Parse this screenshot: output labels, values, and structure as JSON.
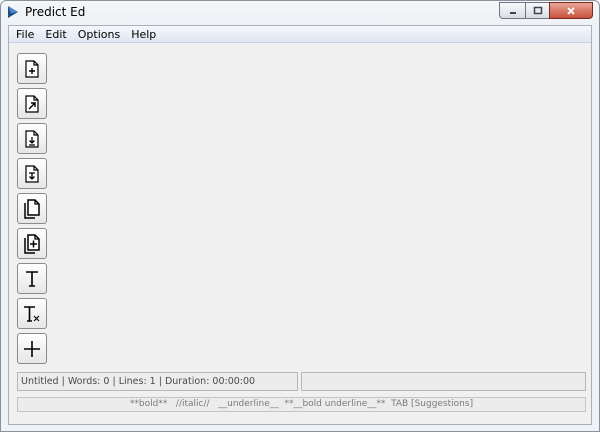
{
  "window": {
    "title": "Predict Ed",
    "icon": "play-triangle-icon",
    "controls": [
      "minimize-icon",
      "maximize-icon",
      "close-icon"
    ]
  },
  "menu": {
    "items": [
      {
        "label": "File"
      },
      {
        "label": "Edit"
      },
      {
        "label": "Options"
      },
      {
        "label": "Help"
      }
    ]
  },
  "toolbar": {
    "buttons": [
      {
        "icon": "new-file-icon"
      },
      {
        "icon": "open-file-icon"
      },
      {
        "icon": "save-file-icon"
      },
      {
        "icon": "save-as-file-icon"
      },
      {
        "icon": "copy-icon"
      },
      {
        "icon": "add-document-icon"
      },
      {
        "icon": "text-icon"
      },
      {
        "icon": "clear-format-icon"
      },
      {
        "icon": "plus-icon"
      }
    ]
  },
  "status": {
    "document_info": "Untitled | Words: 0 | Lines: 1 | Duration: 00:00:00",
    "secondary": ""
  },
  "hint": {
    "text": "**bold**   //italic//   __underline__  **__bold underline__**  TAB [Suggestions]"
  },
  "colors": {
    "close_button": "#c7513c",
    "menubar": "#dfe7f2",
    "client_background": "#f0f0f0"
  }
}
